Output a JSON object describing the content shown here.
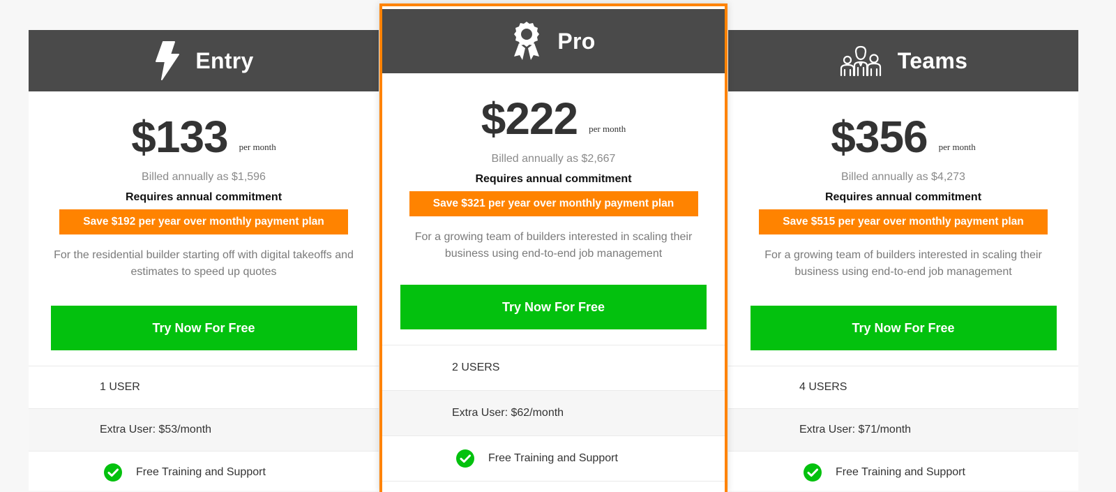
{
  "plans": [
    {
      "name": "Entry",
      "icon": "lightning-bolt-icon",
      "price": "$133",
      "period": "per month",
      "billed": "Billed annually as $1,596",
      "commitment": "Requires annual commitment",
      "savings": "Save $192 per year over monthly payment plan",
      "description": "For the residential builder starting off with digital takeoffs and estimates to speed up quotes",
      "cta": "Try Now For Free",
      "users": "1 USER",
      "extra_user": "Extra User: $53/month",
      "feature": "Free Training and Support"
    },
    {
      "name": "Pro",
      "icon": "award-ribbon-icon",
      "price": "$222",
      "period": "per month",
      "billed": "Billed annually as $2,667",
      "commitment": "Requires annual commitment",
      "savings": "Save $321 per year over monthly payment plan",
      "description": "For a growing team of builders interested in scaling their business using end-to-end job management",
      "cta": "Try Now For Free",
      "users": "2 USERS",
      "extra_user": "Extra User: $62/month",
      "feature": "Free Training and Support"
    },
    {
      "name": "Teams",
      "icon": "team-people-icon",
      "price": "$356",
      "period": "per month",
      "billed": "Billed annually as $4,273",
      "commitment": "Requires annual commitment",
      "savings": "Save $515 per year over monthly payment plan",
      "description": "For a growing team of builders interested in scaling their business using end-to-end job management",
      "cta": "Try Now For Free",
      "users": "4 USERS",
      "extra_user": "Extra User: $71/month",
      "feature": "Free Training and Support"
    }
  ],
  "colors": {
    "header_bg": "#4a4a4a",
    "accent_orange": "#ff8300",
    "cta_green": "#03c10e",
    "check_green": "#03c10e"
  }
}
